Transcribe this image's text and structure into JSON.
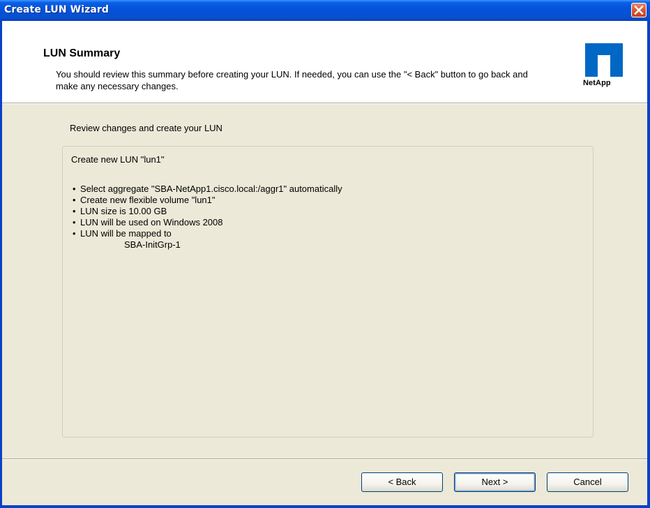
{
  "window": {
    "title": "Create LUN Wizard",
    "close_icon": "close-icon"
  },
  "header": {
    "title": "LUN Summary",
    "description": "You should review this summary before creating your LUN. If needed, you can use the \"< Back\" button to go back and make any necessary changes.",
    "logo_text": "NetApp",
    "logo_icon": "netapp-logo-icon",
    "logo_color": "#0067c5"
  },
  "content": {
    "section_label": "Review changes and create your LUN",
    "summary": {
      "heading": "Create new LUN \"lun1\"",
      "items": [
        "Select aggregate \"SBA-NetApp1.cisco.local:/aggr1\" automatically",
        "Create new flexible volume \"lun1\"",
        "LUN size is 10.00 GB",
        "LUN will be used on Windows 2008",
        "LUN will be mapped to"
      ],
      "mapped_to": "SBA-InitGrp-1"
    }
  },
  "buttons": {
    "back": "< Back",
    "next": "Next >",
    "cancel": "Cancel"
  },
  "colors": {
    "titlebar": "#0553d9",
    "close_button": "#d95a3a",
    "dialog_background": "#ece9d8"
  }
}
